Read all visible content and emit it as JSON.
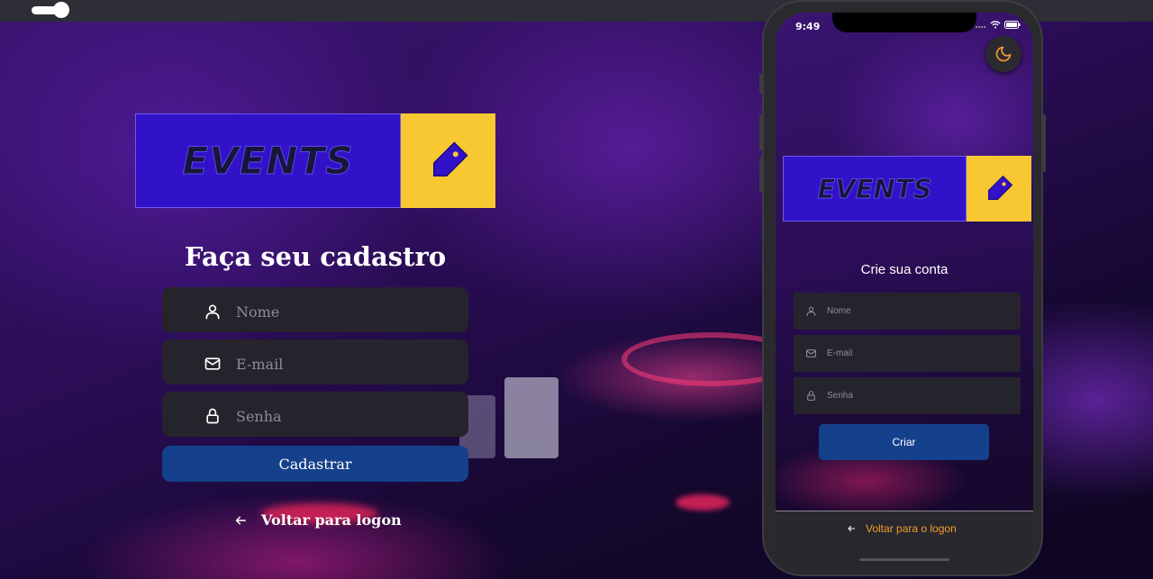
{
  "colors": {
    "logo_blue": "#3212c8",
    "logo_yellow": "#f7c832",
    "button_blue": "#15408b",
    "field_bg": "#25242c",
    "link_orange": "#f59d2a"
  },
  "web": {
    "logo_text": "EVENTS",
    "title": "Faça seu cadastro",
    "fields": {
      "name": {
        "placeholder": "Nome",
        "icon": "user-icon"
      },
      "email": {
        "placeholder": "E-mail",
        "icon": "mail-icon"
      },
      "password": {
        "placeholder": "Senha",
        "icon": "lock-icon"
      }
    },
    "submit_label": "Cadastrar",
    "back_label": "Voltar para logon",
    "back_icon": "arrow-left-icon"
  },
  "phone": {
    "status_time": "9:49",
    "theme_icon": "moon-icon",
    "logo_text": "EVENTS",
    "title": "Crie sua conta",
    "fields": {
      "name": {
        "placeholder": "Nome",
        "icon": "user-icon"
      },
      "email": {
        "placeholder": "E-mail",
        "icon": "mail-icon"
      },
      "password": {
        "placeholder": "Senha",
        "icon": "lock-icon"
      }
    },
    "submit_label": "Criar",
    "back_label": "Voltar para o logon"
  }
}
